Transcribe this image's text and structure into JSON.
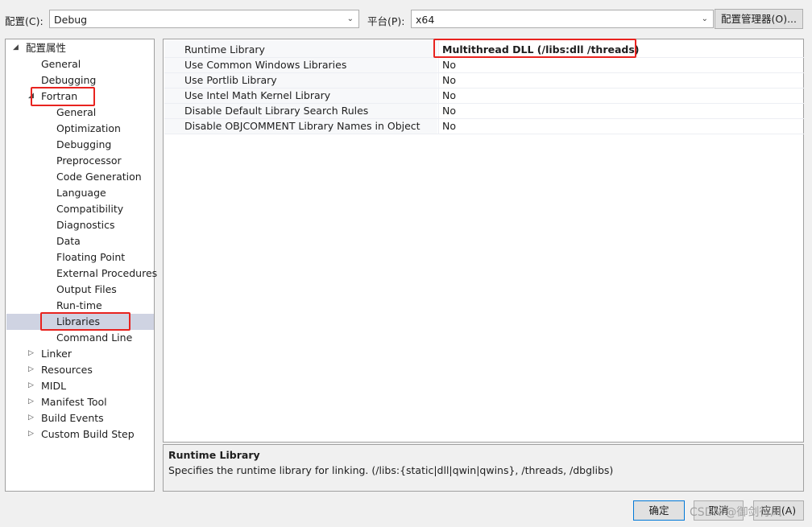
{
  "top": {
    "config_label": "配置(C):",
    "config_value": "Debug",
    "platform_label": "平台(P):",
    "platform_value": "x64",
    "config_manager_button": "配置管理器(O)..."
  },
  "tree": {
    "root": "配置属性",
    "items": [
      "General",
      "Debugging",
      "Fortran",
      "General",
      "Optimization",
      "Debugging",
      "Preprocessor",
      "Code Generation",
      "Language",
      "Compatibility",
      "Diagnostics",
      "Data",
      "Floating Point",
      "External Procedures",
      "Output Files",
      "Run-time",
      "Libraries",
      "Command Line",
      "Linker",
      "Resources",
      "MIDL",
      "Manifest Tool",
      "Build Events",
      "Custom Build Step"
    ],
    "selected": "Libraries"
  },
  "properties": [
    {
      "name": "Runtime Library",
      "value": "Multithread DLL (/libs:dll /threads)"
    },
    {
      "name": "Use Common Windows Libraries",
      "value": "No"
    },
    {
      "name": "Use Portlib Library",
      "value": "No"
    },
    {
      "name": "Use Intel Math Kernel Library",
      "value": "No"
    },
    {
      "name": "Disable Default Library Search Rules",
      "value": "No"
    },
    {
      "name": "Disable OBJCOMMENT Library Names in Object",
      "value": "No"
    }
  ],
  "description": {
    "title": "Runtime Library",
    "text": "Specifies the runtime library for linking. (/libs:{static|dll|qwin|qwins}, /threads, /dbglibs)"
  },
  "buttons": {
    "ok": "确定",
    "cancel": "取消",
    "apply": "应用(A)"
  },
  "watermark": "CSDN @御剑行风",
  "colors": {
    "highlight_box": "#e8231f",
    "selection": "#cfd3e2"
  }
}
